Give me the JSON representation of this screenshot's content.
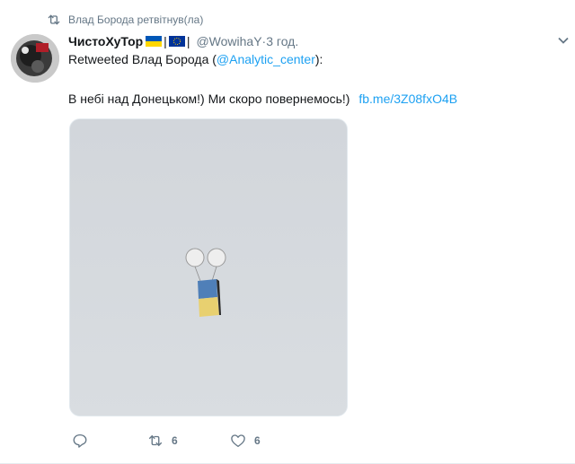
{
  "retweet_context": {
    "label": "Влад Борода ретвітнув(ла)"
  },
  "author": {
    "name": "ЧистоХуТор",
    "separator_1": "|",
    "separator_2": "|",
    "handle": "@WowihaY",
    "dot": " · ",
    "time": "3 год."
  },
  "retweeted_of": {
    "prefix": "Retweeted Влад Борода (",
    "mention": "@Analytic_center",
    "suffix": "):"
  },
  "tweet": {
    "text": "В небі над Донецьком!) Ми скоро повернемось!)",
    "link": "fb.me/3Z08fxO4B"
  },
  "actions": {
    "reply_count": "",
    "retweet_count": "6",
    "like_count": "6"
  },
  "colors": {
    "link": "#1da1f2",
    "muted": "#657786",
    "ua_blue": "#0057b7",
    "ua_yellow": "#ffd700",
    "eu_blue": "#003399"
  }
}
